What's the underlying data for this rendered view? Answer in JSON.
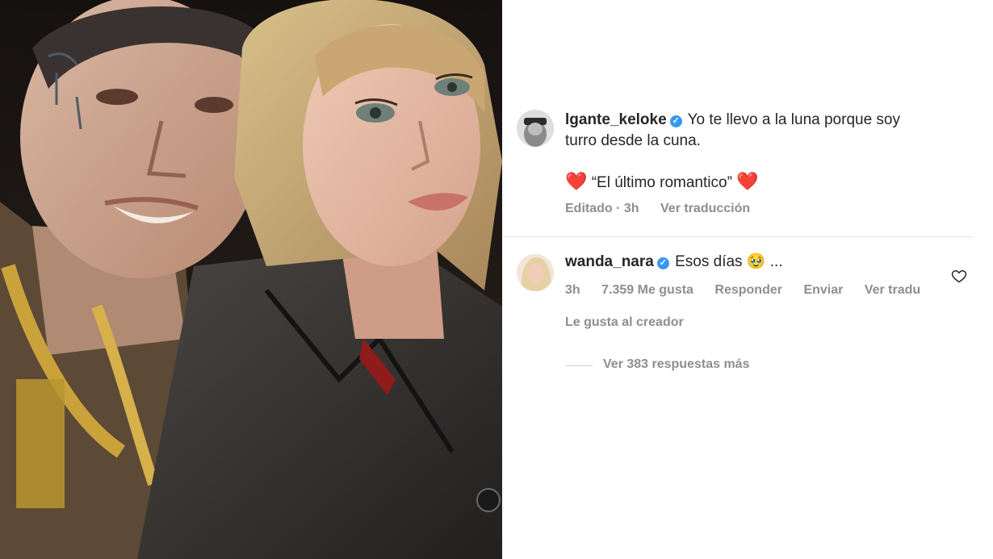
{
  "comments": [
    {
      "username": "lgante_keloke",
      "text_line1": "Yo te llevo a la luna porque soy",
      "text_line2": "turro desde la cuna.",
      "quote": "“El último romantico”",
      "heart_left": "❤️",
      "heart_right": "❤️",
      "meta_edited": "Editado · 3h",
      "meta_translate": "Ver traducción"
    },
    {
      "username": "wanda_nara",
      "text": "Esos días",
      "emoji": "🥹",
      "ellipsis": "...",
      "meta_time": "3h",
      "meta_likes": "7.359 Me gusta",
      "meta_reply": "Responder",
      "meta_send": "Enviar",
      "meta_translate": "Ver tradu",
      "liked_by_creator": "Le gusta al creador",
      "view_replies": "Ver 383 respuestas más"
    }
  ],
  "colors": {
    "text": "#262626",
    "meta": "#8e8e8e",
    "verified": "#3897f0",
    "heart": "#e0252f"
  },
  "icons": [
    "verified-badge-icon",
    "heart-outline-icon",
    "red-heart-emoji"
  ]
}
